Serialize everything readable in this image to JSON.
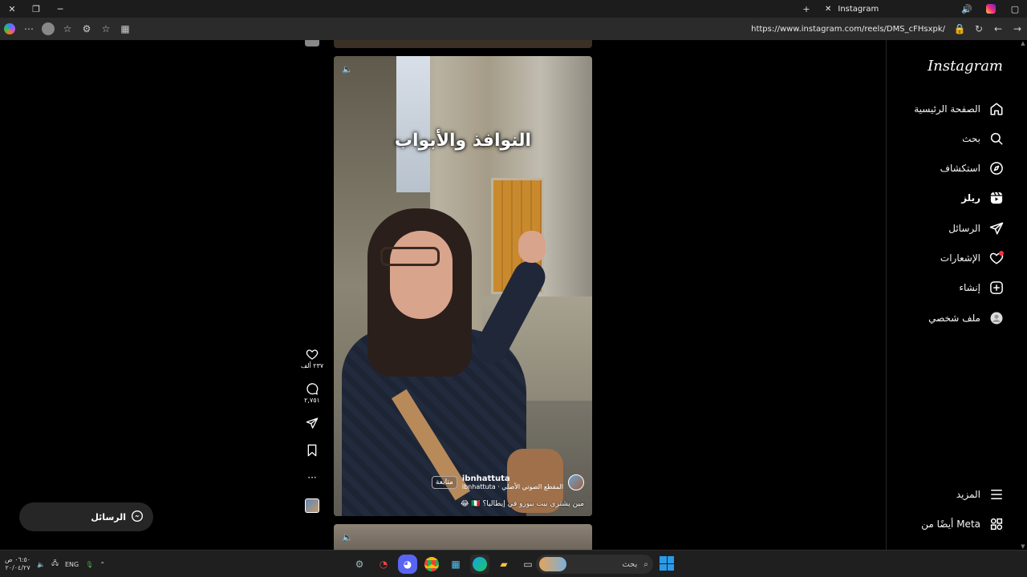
{
  "browser": {
    "tab_title": "Instagram",
    "url": "https://www.instagram.com/reels/DMS_cFHsxpk/"
  },
  "sidebar": {
    "logo": "Instagram",
    "items": [
      {
        "label": "الصفحة الرئيسية",
        "icon": "home-icon"
      },
      {
        "label": "بحث",
        "icon": "search-icon"
      },
      {
        "label": "استكشاف",
        "icon": "compass-icon"
      },
      {
        "label": "ريلز",
        "icon": "reels-icon"
      },
      {
        "label": "الرسائل",
        "icon": "send-icon"
      },
      {
        "label": "الإشعارات",
        "icon": "heart-icon"
      },
      {
        "label": "إنشاء",
        "icon": "create-icon"
      },
      {
        "label": "ملف شخصي",
        "icon": "profile-icon"
      }
    ],
    "more": "المزيد",
    "also_from_meta": "أيضًا من Meta"
  },
  "reel": {
    "overlay_title": "النوافذ والأبواب",
    "author": "ibnhattuta",
    "audio": "المقطع الصوتي الأصلي · ibnhattuta",
    "follow": "متابعة",
    "caption": "مين يشترى بيت بيورو في إيطاليا؟ 🇮🇹 😂"
  },
  "actions": {
    "likes": "٢٣٧ ألف",
    "comments": "٢,٧٥١"
  },
  "messages_pill": "الرسائل",
  "taskbar": {
    "time": "٠٦:٥٠ ص",
    "date": "٢٠/٠٤/٢٧",
    "lang": "ENG",
    "search_placeholder": "بحث"
  }
}
